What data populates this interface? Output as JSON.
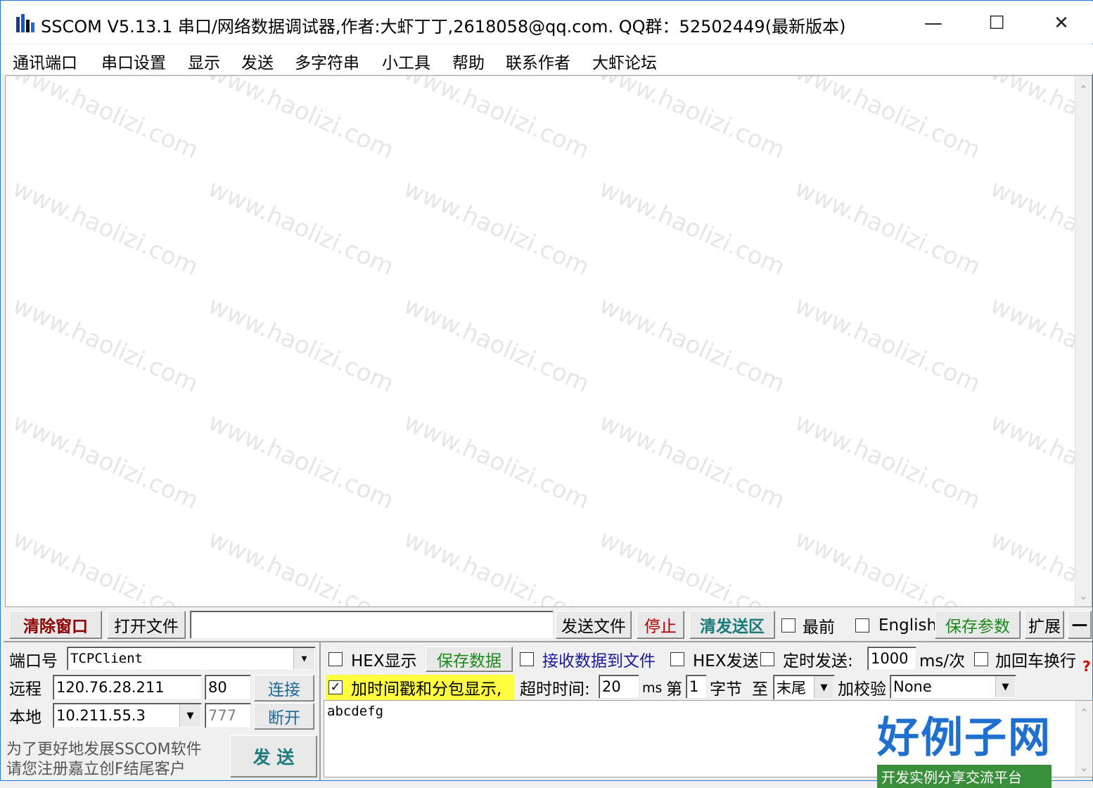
{
  "window": {
    "title": "SSCOM V5.13.1 串口/网络数据调试器,作者:大虾丁丁,2618058@qq.com. QQ群：52502449(最新版本)",
    "minimize_glyph": "—",
    "maximize_glyph": "☐",
    "close_glyph": "✕"
  },
  "menu": [
    "通讯端口",
    "串口设置",
    "显示",
    "发送",
    "多字符串",
    "小工具",
    "帮助",
    "联系作者",
    "大虾论坛"
  ],
  "watermark": "www.haolizi.com",
  "toolbar": {
    "clear_window": "清除窗口",
    "open_file": "打开文件",
    "file_path": "",
    "send_file": "发送文件",
    "stop": "停止",
    "clear_send": "清发送区",
    "topmost": "最前",
    "english": "English",
    "save_params": "保存参数",
    "expand": "扩展",
    "collapse": "—"
  },
  "connection": {
    "port_label": "端口号",
    "port_value": "TCPClient",
    "remote_label": "远程",
    "remote_ip": "120.76.28.211",
    "remote_port": "80",
    "connect": "连接",
    "local_label": "本地",
    "local_ip": "10.211.55.3",
    "local_port": "777",
    "disconnect": "断开",
    "promo_line1": "为了更好地发展SSCOM软件",
    "promo_line2": "请您注册嘉立创F结尾客户",
    "send": "发  送"
  },
  "options": {
    "hex_display": "HEX显示",
    "save_data": "保存数据",
    "recv_to_file": "接收数据到文件",
    "hex_send": "HEX发送",
    "timed_send": "定时发送:",
    "interval": "1000",
    "interval_unit": "ms/次",
    "append_crlf": "加回车换行",
    "timestamp": "加时间戳和分包显示,",
    "timestamp_checked": "✓",
    "timeout_label": "超时时间:",
    "timeout_value": "20",
    "timeout_unit": "ms",
    "byte_prefix": "第",
    "byte_value": "1",
    "byte_suffix": "字节",
    "to_label": "至",
    "to_value": "末尾",
    "checksum_label": "加校验",
    "checksum_value": "None",
    "help_glyph": "?"
  },
  "send_area": {
    "text": "abcdefg"
  },
  "logo": {
    "main": "好例子网",
    "sub": "开发实例分享交流平台"
  }
}
